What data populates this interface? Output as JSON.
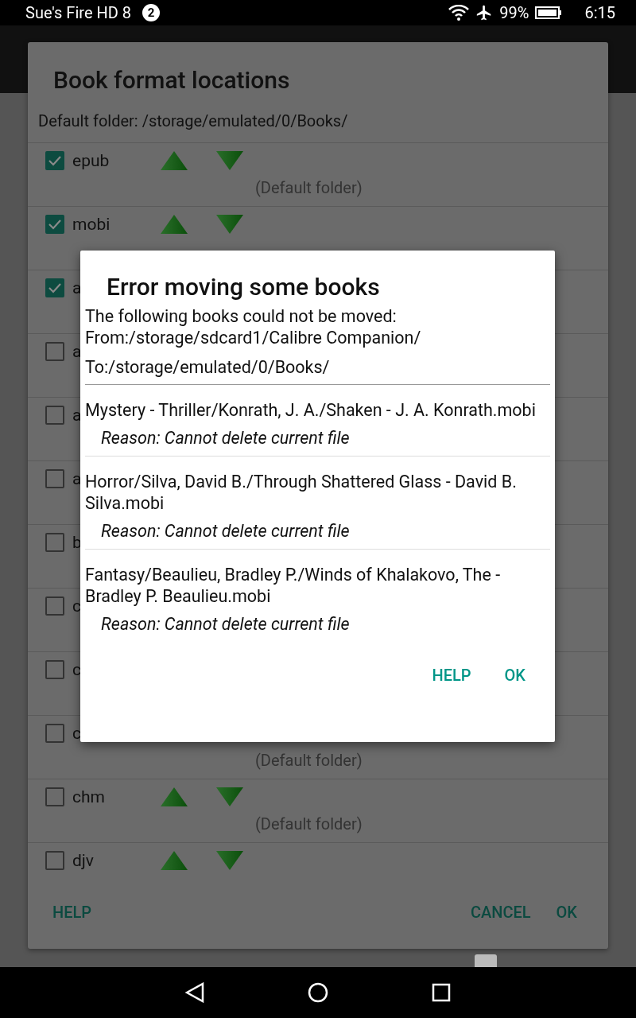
{
  "status_bar": {
    "device": "Sue's Fire HD 8",
    "notification_count": "2",
    "battery": "99%",
    "time": "6:15"
  },
  "format_dialog": {
    "title": "Book format locations",
    "default_folder": "Default folder: /storage/emulated/0/Books/",
    "formats": [
      {
        "label": "epub",
        "checked": true,
        "kind": "full",
        "location": "(Default folder)"
      },
      {
        "label": "mobi",
        "checked": true,
        "kind": "full"
      },
      {
        "label": "a",
        "checked": true,
        "kind": "covered"
      },
      {
        "label": "a",
        "checked": false,
        "kind": "covered"
      },
      {
        "label": "a",
        "checked": false,
        "kind": "covered"
      },
      {
        "label": "a",
        "checked": false,
        "kind": "covered"
      },
      {
        "label": "b",
        "checked": false,
        "kind": "covered"
      },
      {
        "label": "c",
        "checked": false,
        "kind": "covered"
      },
      {
        "label": "c",
        "checked": false,
        "kind": "covered"
      },
      {
        "label": "c",
        "checked": false,
        "kind": "covered",
        "location": "(Default folder)"
      },
      {
        "label": "chm",
        "checked": false,
        "kind": "full",
        "location": "(Default folder)"
      },
      {
        "label": "djv",
        "checked": false,
        "kind": "full"
      }
    ],
    "buttons": [
      {
        "label": "HELP",
        "kind": "left"
      },
      {
        "label": "CANCEL",
        "kind": "right"
      },
      {
        "label": "OK",
        "kind": "right"
      }
    ]
  },
  "error_dialog": {
    "title": "Error moving some books",
    "intro": "The following books could not be moved:",
    "from": "From:/storage/sdcard1/Calibre Companion/",
    "to": "To:/storage/emulated/0/Books/",
    "books": [
      {
        "path": "Mystery - Thriller/Konrath, J. A./Shaken - J. A. Konrath.mobi",
        "reason": "Reason: Cannot delete current file"
      },
      {
        "path": "Horror/Silva, David B./Through Shattered Glass - David B. Silva.mobi",
        "reason": "Reason: Cannot delete current file"
      },
      {
        "path": "Fantasy/Beaulieu, Bradley P./Winds of Khalakovo, The - Bradley P. Beaulieu.mobi",
        "reason": "Reason: Cannot delete current file"
      }
    ],
    "buttons": [
      {
        "label": "HELP"
      },
      {
        "label": "OK"
      }
    ]
  }
}
